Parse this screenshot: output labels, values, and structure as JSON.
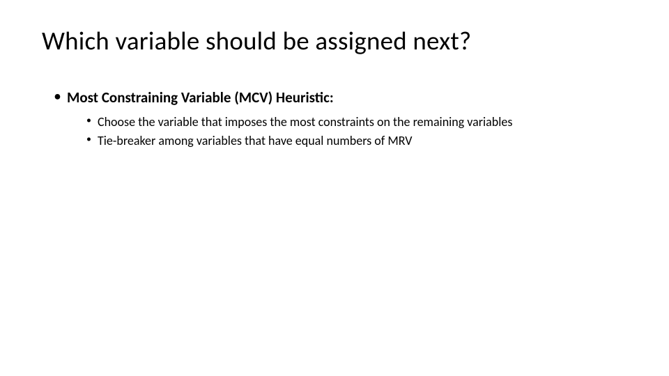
{
  "title": "Which variable should be assigned next?",
  "bullets": {
    "item1": {
      "label": "Most Constraining Variable (MCV) Heuristic:",
      "sub": {
        "s1": "Choose the variable that imposes the most constraints on the remaining variables",
        "s2": "Tie-breaker among variables that have equal numbers of MRV"
      }
    }
  }
}
